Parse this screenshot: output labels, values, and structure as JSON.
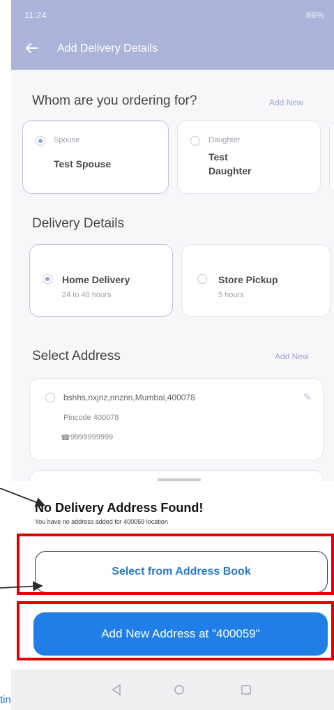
{
  "status_bar": {
    "time": "11:24",
    "indicators": "86%"
  },
  "header": {
    "title": "Add Delivery Details",
    "back_icon": "arrow-left-icon"
  },
  "ordering_for": {
    "heading": "Whom are you ordering for?",
    "add_new": "Add New",
    "options": [
      {
        "relation": "Spouse",
        "name": "Test Spouse",
        "selected": true
      },
      {
        "relation": "Daughter",
        "name": "Test\nDaughter",
        "selected": false
      }
    ]
  },
  "delivery_details": {
    "heading": "Delivery Details",
    "options": [
      {
        "label": "Home Delivery",
        "time": "24 to 48 hours",
        "selected": true
      },
      {
        "label": "Store Pickup",
        "time": "5 hours",
        "selected": false
      }
    ]
  },
  "select_address": {
    "heading": "Select Address",
    "add_new": "Add New",
    "address": {
      "line1": "bshhs,nxjnz,nnznn,Mumbai,400078",
      "pincode": "Pincode 400078",
      "phone": "9999999999"
    }
  },
  "sheet": {
    "title": "No Delivery Address Found!",
    "subtitle": "You have no address added for 400059 location",
    "select_from_book": "Select from Address Book",
    "add_new_address": "Add New Address at \"400059\""
  },
  "footer_text": "tin",
  "colors": {
    "accent": "#1f7fe6",
    "header": "#aab5d9",
    "highlight": "#e00000"
  }
}
